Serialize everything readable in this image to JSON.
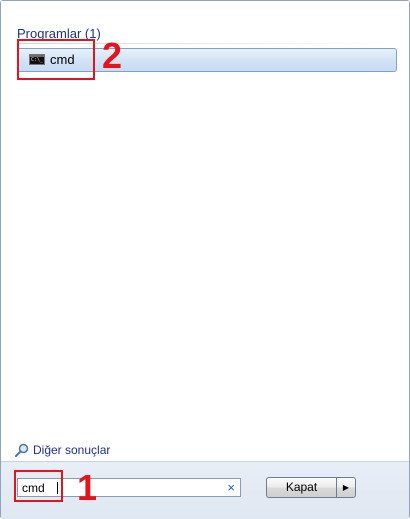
{
  "results": {
    "group_header": "Programlar (1)",
    "items": [
      {
        "label": "cmd",
        "icon": "command-prompt-icon"
      }
    ]
  },
  "more_results": {
    "label": "Diğer sonuçlar",
    "icon": "magnifier-icon"
  },
  "search": {
    "value": "cmd",
    "clear_icon": "×"
  },
  "shutdown": {
    "label": "Kapat",
    "arrow": "▶"
  },
  "annotations": {
    "step1": "1",
    "step2": "2",
    "color": "#e4141c"
  },
  "colors": {
    "header_text": "#1e3287",
    "selection_border": "#7da2ce",
    "footer_bg": "#e3eaf4"
  }
}
